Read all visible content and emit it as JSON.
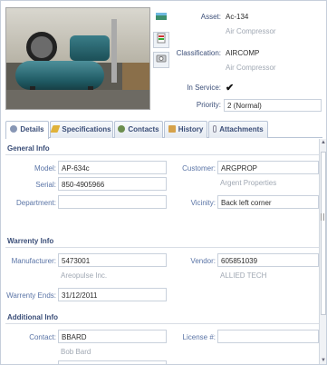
{
  "asset": {
    "asset_label": "Asset:",
    "asset_value": "Ac-134",
    "asset_desc": "Air Compressor",
    "classification_label": "Classification:",
    "classification_value": "AIRCOMP",
    "classification_desc": "Air Compressor",
    "in_service_label": "In Service:",
    "in_service_check": "✔",
    "priority_label": "Priority:",
    "priority_value": "2 (Normal)"
  },
  "tabs": [
    {
      "label": "Details"
    },
    {
      "label": "Specifications"
    },
    {
      "label": "Contacts"
    },
    {
      "label": "History"
    },
    {
      "label": "Attachments"
    }
  ],
  "general": {
    "title": "General Info",
    "model_label": "Model:",
    "model_value": "AP-634c",
    "serial_label": "Serial:",
    "serial_value": "850-4905966",
    "department_label": "Department:",
    "department_value": "",
    "customer_label": "Customer:",
    "customer_value": "ARGPROP",
    "customer_desc": "Argent Properties",
    "vicinity_label": "Vicinity:",
    "vicinity_value": "Back left corner"
  },
  "warranty": {
    "title": "Warrenty Info",
    "manufacturer_label": "Manufacturer:",
    "manufacturer_value": "5473001",
    "manufacturer_desc": "Areopulse Inc.",
    "vendor_label": "Vendor:",
    "vendor_value": "605851039",
    "vendor_desc": "ALLIED TECH",
    "ends_label": "Warrenty Ends:",
    "ends_value": "31/12/2011"
  },
  "additional": {
    "title": "Additional Info",
    "contact_label": "Contact:",
    "contact_value": "BBARD",
    "contact_desc": "Bob Bard",
    "license_label": "License #:",
    "license_value": ""
  },
  "colors": {
    "label_blue": "#5a74a6",
    "heading_blue": "#3b4e78",
    "border": "#c9d1dc"
  }
}
